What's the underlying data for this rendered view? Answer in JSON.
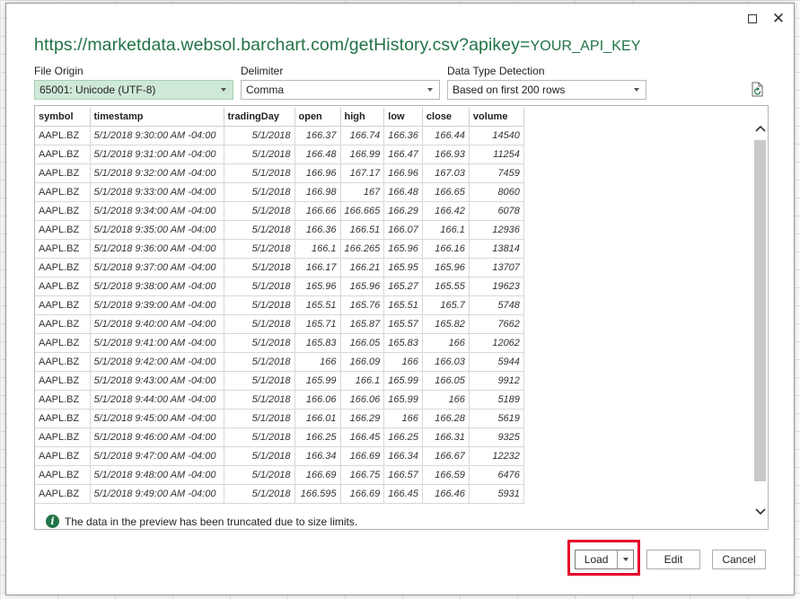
{
  "dialog": {
    "title_url": "https://marketdata.websol.barchart.com/getHistory.csv?apikey=",
    "title_key": "YOUR_API_KEY"
  },
  "options": {
    "file_origin": {
      "label": "File Origin",
      "value": "65001: Unicode (UTF-8)"
    },
    "delimiter": {
      "label": "Delimiter",
      "value": "Comma"
    },
    "detection": {
      "label": "Data Type Detection",
      "value": "Based on first 200 rows"
    }
  },
  "table": {
    "headers": [
      "symbol",
      "timestamp",
      "tradingDay",
      "open",
      "high",
      "low",
      "close",
      "volume"
    ],
    "rows": [
      [
        "AAPL.BZ",
        "5/1/2018 9:30:00 AM -04:00",
        "5/1/2018",
        "166.37",
        "166.74",
        "166.36",
        "166.44",
        "14540"
      ],
      [
        "AAPL.BZ",
        "5/1/2018 9:31:00 AM -04:00",
        "5/1/2018",
        "166.48",
        "166.99",
        "166.47",
        "166.93",
        "11254"
      ],
      [
        "AAPL.BZ",
        "5/1/2018 9:32:00 AM -04:00",
        "5/1/2018",
        "166.96",
        "167.17",
        "166.96",
        "167.03",
        "7459"
      ],
      [
        "AAPL.BZ",
        "5/1/2018 9:33:00 AM -04:00",
        "5/1/2018",
        "166.98",
        "167",
        "166.48",
        "166.65",
        "8060"
      ],
      [
        "AAPL.BZ",
        "5/1/2018 9:34:00 AM -04:00",
        "5/1/2018",
        "166.66",
        "166.665",
        "166.29",
        "166.42",
        "6078"
      ],
      [
        "AAPL.BZ",
        "5/1/2018 9:35:00 AM -04:00",
        "5/1/2018",
        "166.36",
        "166.51",
        "166.07",
        "166.1",
        "12936"
      ],
      [
        "AAPL.BZ",
        "5/1/2018 9:36:00 AM -04:00",
        "5/1/2018",
        "166.1",
        "166.265",
        "165.96",
        "166.16",
        "13814"
      ],
      [
        "AAPL.BZ",
        "5/1/2018 9:37:00 AM -04:00",
        "5/1/2018",
        "166.17",
        "166.21",
        "165.95",
        "165.96",
        "13707"
      ],
      [
        "AAPL.BZ",
        "5/1/2018 9:38:00 AM -04:00",
        "5/1/2018",
        "165.96",
        "165.96",
        "165.27",
        "165.55",
        "19623"
      ],
      [
        "AAPL.BZ",
        "5/1/2018 9:39:00 AM -04:00",
        "5/1/2018",
        "165.51",
        "165.76",
        "165.51",
        "165.7",
        "5748"
      ],
      [
        "AAPL.BZ",
        "5/1/2018 9:40:00 AM -04:00",
        "5/1/2018",
        "165.71",
        "165.87",
        "165.57",
        "165.82",
        "7662"
      ],
      [
        "AAPL.BZ",
        "5/1/2018 9:41:00 AM -04:00",
        "5/1/2018",
        "165.83",
        "166.05",
        "165.83",
        "166",
        "12062"
      ],
      [
        "AAPL.BZ",
        "5/1/2018 9:42:00 AM -04:00",
        "5/1/2018",
        "166",
        "166.09",
        "166",
        "166.03",
        "5944"
      ],
      [
        "AAPL.BZ",
        "5/1/2018 9:43:00 AM -04:00",
        "5/1/2018",
        "165.99",
        "166.1",
        "165.99",
        "166.05",
        "9912"
      ],
      [
        "AAPL.BZ",
        "5/1/2018 9:44:00 AM -04:00",
        "5/1/2018",
        "166.06",
        "166.06",
        "165.99",
        "166",
        "5189"
      ],
      [
        "AAPL.BZ",
        "5/1/2018 9:45:00 AM -04:00",
        "5/1/2018",
        "166.01",
        "166.29",
        "166",
        "166.28",
        "5619"
      ],
      [
        "AAPL.BZ",
        "5/1/2018 9:46:00 AM -04:00",
        "5/1/2018",
        "166.25",
        "166.45",
        "166.25",
        "166.31",
        "9325"
      ],
      [
        "AAPL.BZ",
        "5/1/2018 9:47:00 AM -04:00",
        "5/1/2018",
        "166.34",
        "166.69",
        "166.34",
        "166.67",
        "12232"
      ],
      [
        "AAPL.BZ",
        "5/1/2018 9:48:00 AM -04:00",
        "5/1/2018",
        "166.69",
        "166.75",
        "166.57",
        "166.59",
        "6476"
      ],
      [
        "AAPL.BZ",
        "5/1/2018 9:49:00 AM -04:00",
        "5/1/2018",
        "166.595",
        "166.69",
        "166.45",
        "166.46",
        "5931"
      ]
    ]
  },
  "truncation_note": "The data in the preview has been truncated due to size limits.",
  "buttons": {
    "load": "Load",
    "edit": "Edit",
    "cancel": "Cancel"
  },
  "colors": {
    "accent": "#217346",
    "active_select": "#cfe9d8",
    "highlight": "#e4002b"
  }
}
